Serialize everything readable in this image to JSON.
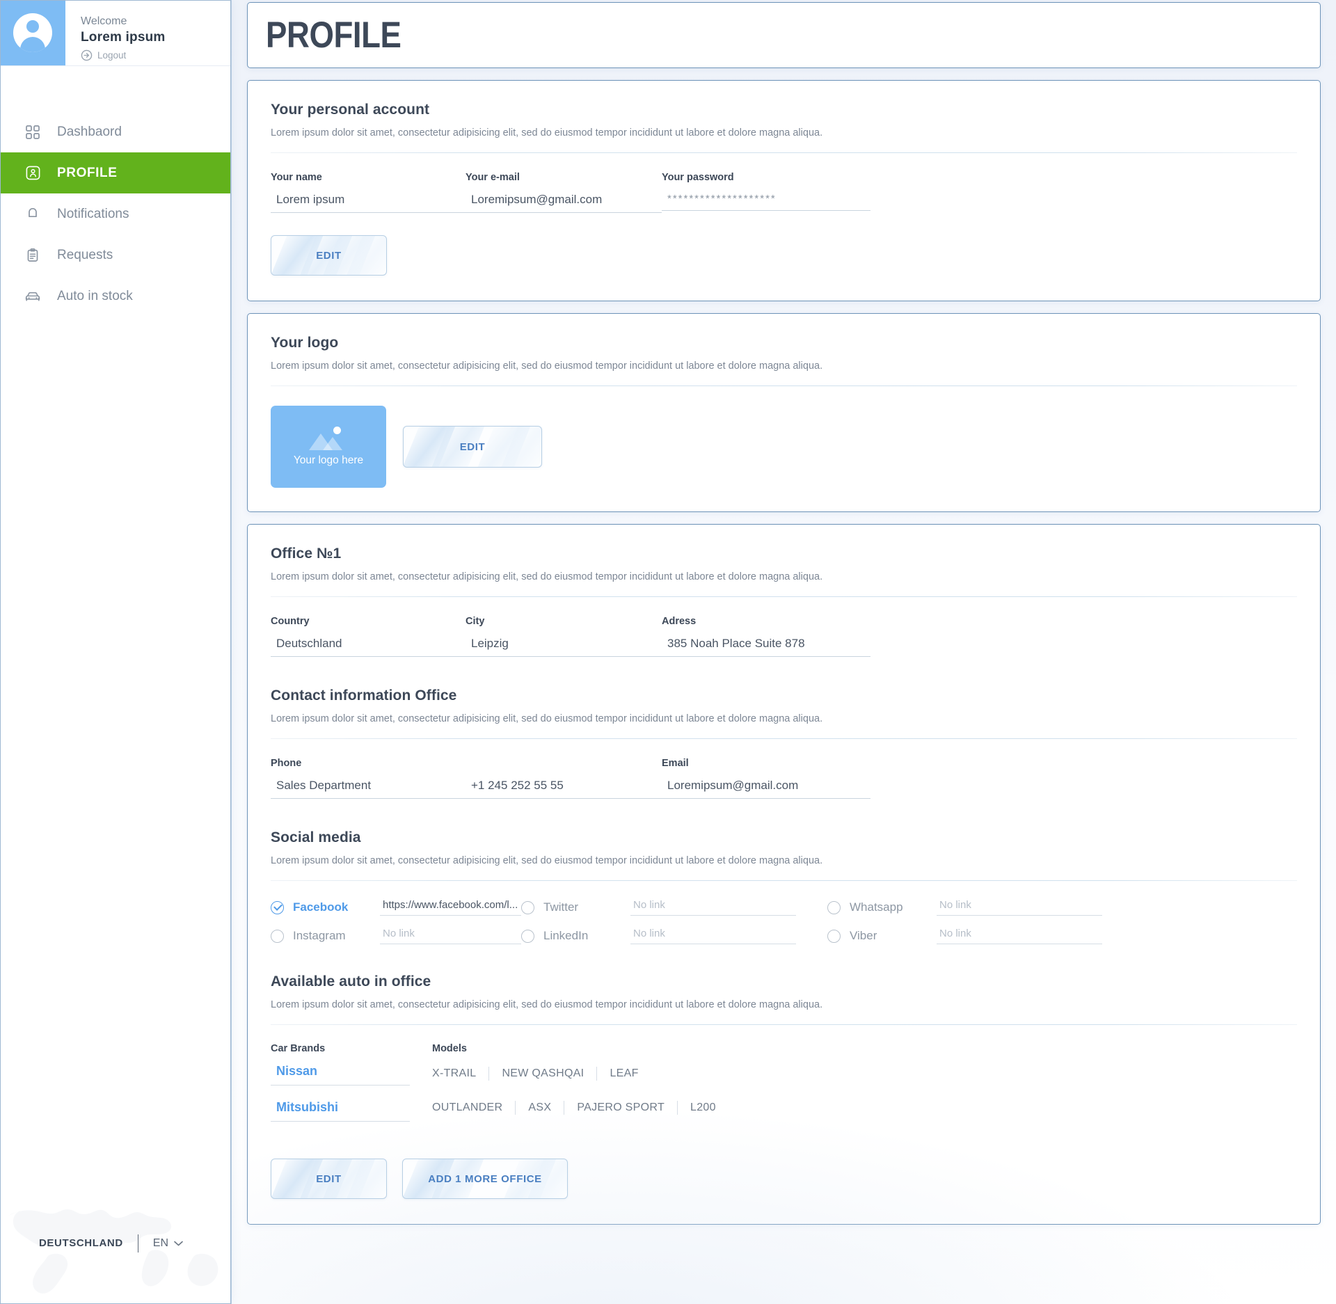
{
  "sidebar": {
    "welcome_label": "Welcome",
    "user_name": "Lorem ipsum",
    "logout_label": "Logout",
    "nav": [
      {
        "label": "Dashbaord",
        "icon": "grid-icon",
        "active": false
      },
      {
        "label": "PROFILE",
        "icon": "user-badge-icon",
        "active": true
      },
      {
        "label": "Notifications",
        "icon": "bell-icon",
        "active": false
      },
      {
        "label": "Requests",
        "icon": "clipboard-icon",
        "active": false
      },
      {
        "label": "Auto in stock",
        "icon": "car-icon",
        "active": false
      }
    ],
    "footer": {
      "country": "DEUTSCHLAND",
      "language": "EN"
    }
  },
  "header": {
    "title": "PROFILE"
  },
  "account": {
    "title": "Your personal account",
    "description": "Lorem ipsum dolor sit amet, consectetur adipisicing elit, sed do eiusmod tempor incididunt ut labore et dolore magna aliqua.",
    "fields": [
      {
        "label": "Your name",
        "value": "Lorem ipsum",
        "placeholder": "Your name"
      },
      {
        "label": "Your e-mail",
        "value": "Loremipsum@gmail.com",
        "placeholder": "Your e-mail"
      },
      {
        "label": "Your password",
        "value": "********************",
        "placeholder": "Your password"
      }
    ],
    "edit_label": "EDIT"
  },
  "logo": {
    "title": "Your logo",
    "description": "Lorem ipsum dolor sit amet, consectetur adipisicing elit, sed do eiusmod tempor incididunt ut labore et dolore magna aliqua.",
    "placeholder_text": "Your logo here",
    "edit_label": "EDIT"
  },
  "office": {
    "title": "Office №1",
    "description": "Lorem ipsum dolor sit amet, consectetur adipisicing elit, sed do eiusmod tempor incididunt ut labore et dolore magna aliqua.",
    "fields": [
      {
        "label": "Country",
        "value": "Deutschland",
        "placeholder": "Country"
      },
      {
        "label": "City",
        "value": "Leipzig",
        "placeholder": "City"
      },
      {
        "label": "Adress",
        "value": "385 Noah Place Suite 878",
        "placeholder": "Adress"
      }
    ],
    "contact": {
      "title": "Contact information Office",
      "description": "Lorem ipsum dolor sit amet, consectetur adipisicing elit, sed do eiusmod tempor incididunt ut labore et dolore magna aliqua.",
      "phone_label": "Phone",
      "phone_name": "Sales Department",
      "phone_number": "+1 245 252 55 55",
      "email_label": "Email",
      "email_value": "Loremipsum@gmail.com"
    },
    "social": {
      "title": "Social media",
      "description": "Lorem ipsum dolor sit amet, consectetur adipisicing elit, sed do eiusmod tempor incididunt ut labore et dolore magna aliqua.",
      "no_link_placeholder": "No link",
      "items": [
        {
          "name": "Facebook",
          "checked": true,
          "link": "https://www.facebook.com/l..."
        },
        {
          "name": "Instagram",
          "checked": false,
          "link": ""
        },
        {
          "name": "Twitter",
          "checked": false,
          "link": ""
        },
        {
          "name": "LinkedIn",
          "checked": false,
          "link": ""
        },
        {
          "name": "Whatsapp",
          "checked": false,
          "link": ""
        },
        {
          "name": "Viber",
          "checked": false,
          "link": ""
        }
      ]
    },
    "autos": {
      "title": "Available auto in office",
      "description": "Lorem ipsum dolor sit amet, consectetur adipisicing elit, sed do eiusmod tempor incididunt ut labore et dolore magna aliqua.",
      "brands_label": "Car Brands",
      "models_label": "Models",
      "rows": [
        {
          "brand": "Nissan",
          "models": [
            "X-TRAIL",
            "NEW QASHQAI",
            "LEAF"
          ]
        },
        {
          "brand": "Mitsubishi",
          "models": [
            "OUTLANDER",
            "ASX",
            "PAJERO SPORT",
            "L200"
          ]
        }
      ]
    },
    "edit_label": "EDIT",
    "add_office_label": "ADD 1 MORE OFFICE"
  },
  "colors": {
    "accent_green": "#62b21c",
    "accent_blue": "#4f9ae8",
    "logo_blue": "#7ebcf4",
    "title_dark": "#3d4858",
    "muted": "#7d8795"
  }
}
